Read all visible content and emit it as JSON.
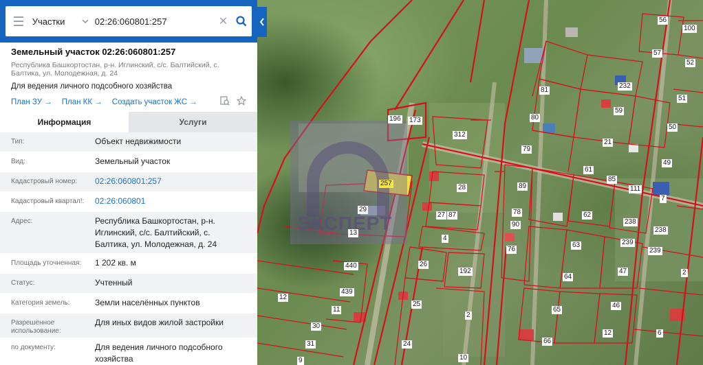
{
  "search": {
    "type": "Участки",
    "query": "02:26:060801:257"
  },
  "plot": {
    "title": "Земельный участок 02:26:060801:257",
    "address": "Республика Башкортостан, р-н. Иглинский, с/с. Балтийский, с. Балтика, ул. Молодежная, д. 24",
    "purpose": "Для ведения личного подсобного хозяйства"
  },
  "links": {
    "plan_zu": "План ЗУ →",
    "plan_kk": "План КК →",
    "create": "Создать участок ЖС →"
  },
  "tabs": {
    "info": "Информация",
    "services": "Услуги"
  },
  "info_rows": [
    {
      "key": "Тип:",
      "value": "Объект недвижимости"
    },
    {
      "key": "Вид:",
      "value": "Земельный участок"
    },
    {
      "key": "Кадастровый номер:",
      "value": "02:26:060801:257"
    },
    {
      "key": "Кадастровый квартал!:",
      "value": "02:26:060801"
    },
    {
      "key": "Адрес:",
      "value": "Республика Башкортостан, р-н. Иглинский, с/с. Балтийский, с. Балтика, ул. Молодежная, д. 24"
    },
    {
      "key": "Площадь уточненная:",
      "value": "1 202 кв. м"
    },
    {
      "key": "Статус:",
      "value": "Учтенный"
    },
    {
      "key": "Категория земель:",
      "value": "Земли населённых пунктов"
    },
    {
      "key": "Разрешенное использование:",
      "value": "Для иных видов жилой застройки"
    },
    {
      "key": "по документу:",
      "value": "Для ведения личного подсобного хозяйства"
    }
  ],
  "map": {
    "watermark": "ЭКСПЕРТ",
    "selected_plot": "257",
    "plot_labels": [
      "56",
      "100",
      "57",
      "52",
      "51",
      "81",
      "232",
      "59",
      "196",
      "173",
      "80",
      "312",
      "21",
      "50",
      "79",
      "28",
      "61",
      "85",
      "111",
      "49",
      "89",
      "7",
      "257",
      "78",
      "62",
      "29",
      "27",
      "87",
      "90",
      "238",
      "238",
      "13",
      "4",
      "76",
      "63",
      "239",
      "239",
      "440",
      "26",
      "192",
      "47",
      "2",
      "439",
      "64",
      "12",
      "25",
      "11",
      "46",
      "30",
      "2",
      "65",
      "31",
      "24",
      "66",
      "12",
      "6",
      "9",
      "10"
    ]
  },
  "colors": {
    "brand": "#1565c0",
    "link": "#1a73c7",
    "boundary": "#d4101a",
    "selected": "#f5e642"
  }
}
